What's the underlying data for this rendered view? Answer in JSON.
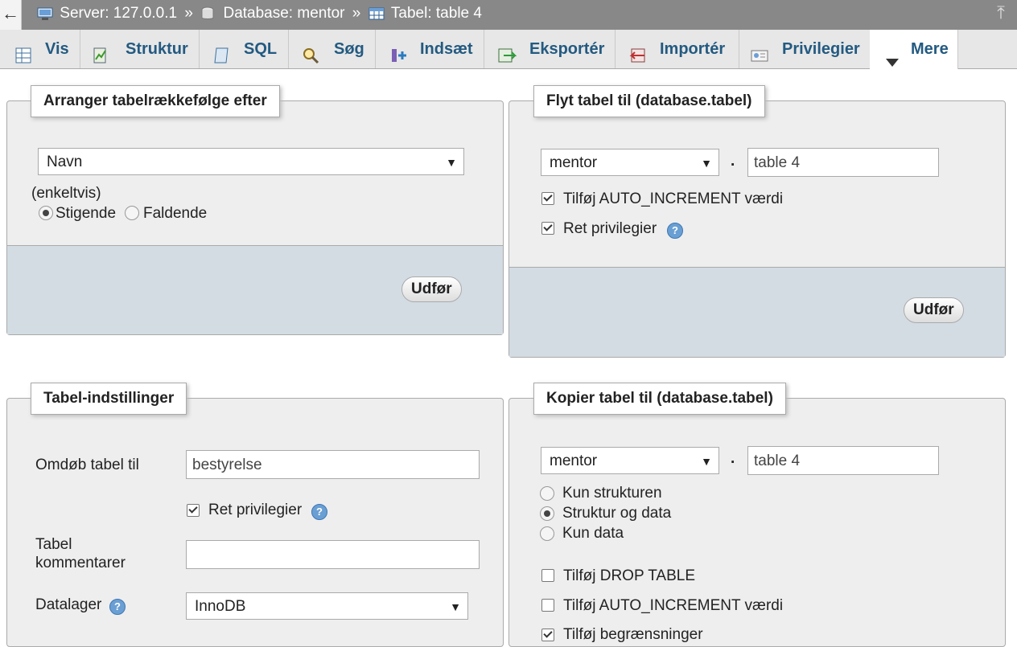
{
  "breadcrumb": {
    "back": "←",
    "server": "Server: 127.0.0.1",
    "database": "Database: mentor",
    "table": "Tabel: table 4",
    "separator": "»"
  },
  "tabs": [
    {
      "label": "Vis",
      "icon": "browse-icon"
    },
    {
      "label": "Struktur",
      "icon": "structure-icon"
    },
    {
      "label": "SQL",
      "icon": "sql-icon"
    },
    {
      "label": "Søg",
      "icon": "search-icon"
    },
    {
      "label": "Indsæt",
      "icon": "insert-icon"
    },
    {
      "label": "Eksportér",
      "icon": "export-icon"
    },
    {
      "label": "Importér",
      "icon": "import-icon"
    },
    {
      "label": "Privilegier",
      "icon": "privileges-icon"
    },
    {
      "label": "Mere",
      "icon": "triangle-down-icon"
    }
  ],
  "order_panel": {
    "legend": "Arranger tabelrækkefølge efter",
    "select_value": "Navn",
    "mode": "(enkeltvis)",
    "asc": "Stigende",
    "desc": "Faldende",
    "submit": "Udfør"
  },
  "move_panel": {
    "legend": "Flyt tabel til (database.tabel)",
    "db_value": "mentor",
    "dot": ".",
    "table_value": "table 4",
    "auto_increment": "Tilføj AUTO_INCREMENT værdi",
    "adjust_privileges": "Ret privilegier",
    "submit": "Udfør"
  },
  "options_panel": {
    "legend": "Tabel-indstillinger",
    "rename_label": "Omdøb tabel til",
    "rename_value": "bestyrelse",
    "adjust_privileges": "Ret privilegier",
    "comments_label_1": "Tabel",
    "comments_label_2": "kommentarer",
    "comments_value": "",
    "engine_label": "Datalager",
    "engine_value": "InnoDB"
  },
  "copy_panel": {
    "legend": "Kopier tabel til (database.tabel)",
    "db_value": "mentor",
    "dot": ".",
    "table_value": "table 4",
    "structure_only": "Kun strukturen",
    "structure_and_data": "Struktur og data",
    "data_only": "Kun data",
    "drop_table": "Tilføj DROP TABLE",
    "auto_increment": "Tilføj AUTO_INCREMENT værdi",
    "constraints": "Tilføj begrænsninger"
  },
  "colors": {
    "topbar": "#888888",
    "tab_text": "#235a81",
    "panel_bg": "#eeeeee",
    "footer_bg": "#d3dce3"
  }
}
